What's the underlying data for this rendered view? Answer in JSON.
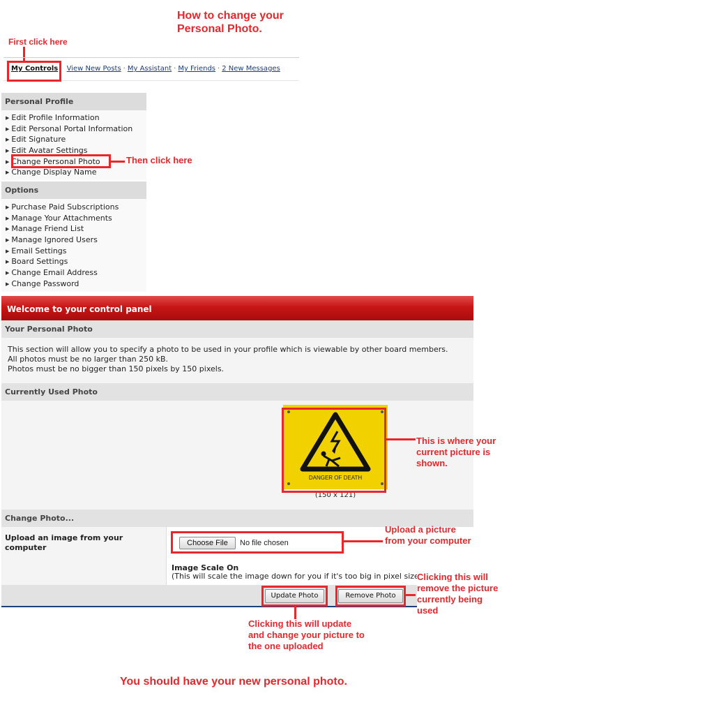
{
  "annotations": {
    "title": "How to change your Personal Photo.",
    "first_click": "First click here",
    "then_click": "Then click here",
    "current_picture": "This is where your current picture is shown.",
    "upload_picture": "Upload a picture from your computer",
    "remove_note": "Clicking this will remove the picture currently being used",
    "update_note": "Clicking this will update and change your picture to the one uploaded",
    "final_note": "You should have your new personal photo."
  },
  "topnav": {
    "my_controls": "My Controls",
    "view_new_posts": "View New Posts",
    "my_assistant": "My Assistant",
    "my_friends": "My Friends",
    "new_messages": "2 New Messages",
    "separator": "·"
  },
  "sidebar": {
    "personal_profile": {
      "heading": "Personal Profile",
      "items": [
        "Edit Profile Information",
        "Edit Personal Portal Information",
        "Edit Signature",
        "Edit Avatar Settings",
        "Change Personal Photo",
        "Change Display Name"
      ]
    },
    "options": {
      "heading": "Options",
      "items": [
        "Purchase Paid Subscriptions",
        "Manage Your Attachments",
        "Manage Friend List",
        "Manage Ignored Users",
        "Email Settings",
        "Board Settings",
        "Change Email Address",
        "Change Password"
      ]
    }
  },
  "panel": {
    "title": "Welcome to your control panel",
    "your_photo_heading": "Your Personal Photo",
    "desc": [
      "This section will allow you to specify a photo to be used in your profile which is viewable by other board members.",
      "All photos must be no larger than 250 kB.",
      "Photos must be no bigger than 150 pixels by 150 pixels."
    ],
    "current_heading": "Currently Used Photo",
    "photo_sign_text": "DANGER OF DEATH",
    "photo_caption": "(150 x 121)",
    "change_heading": "Change Photo...",
    "upload_label": "Upload an image from your computer",
    "choose_file": "Choose File",
    "no_file": "No file chosen",
    "scale_title": "Image Scale On",
    "scale_desc": "(This will scale the image down for you if it's too big in pixel size)",
    "update_button": "Update Photo",
    "remove_button": "Remove Photo"
  },
  "colors": {
    "annotation_red": "#e8262c",
    "header_red": "#c81515",
    "sign_yellow": "#f2d100"
  }
}
